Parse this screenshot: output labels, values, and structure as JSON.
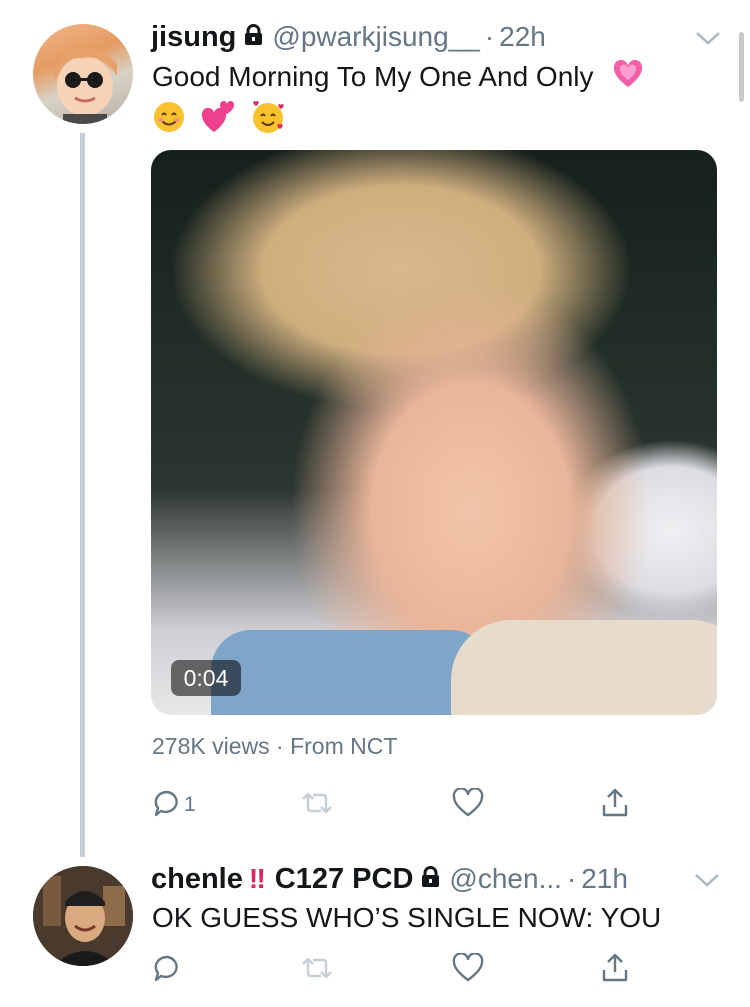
{
  "tweets": [
    {
      "name": "jisung",
      "handle": "@pwarkjisung__",
      "time": "22h",
      "text": "Good Morning To My One And Only",
      "emoji_line1": [
        "growing-heart-emoji"
      ],
      "emoji_line2": [
        "smiling-face-emoji",
        "two-hearts-emoji",
        "smiling-face-with-hearts-emoji"
      ],
      "video_duration": "0:04",
      "views": "278K views",
      "source": "From NCT",
      "reply_count": "1"
    },
    {
      "name": "chenle",
      "badge": "‼",
      "name_suffix": "C127 PCD",
      "handle": "@chen...",
      "time": "21h",
      "text": "OK GUESS WHO’S SINGLE NOW: YOU"
    }
  ],
  "separator": "·",
  "icons": [
    "lock-icon",
    "chevron-down-icon",
    "reply-icon",
    "retweet-icon",
    "like-icon",
    "share-icon"
  ],
  "colors": {
    "text": "#14171a",
    "secondary": "#657786",
    "thread_line": "#c4cfd6",
    "badge_red": "#e0245e",
    "retweet_disabled": "#c4cfd6"
  }
}
